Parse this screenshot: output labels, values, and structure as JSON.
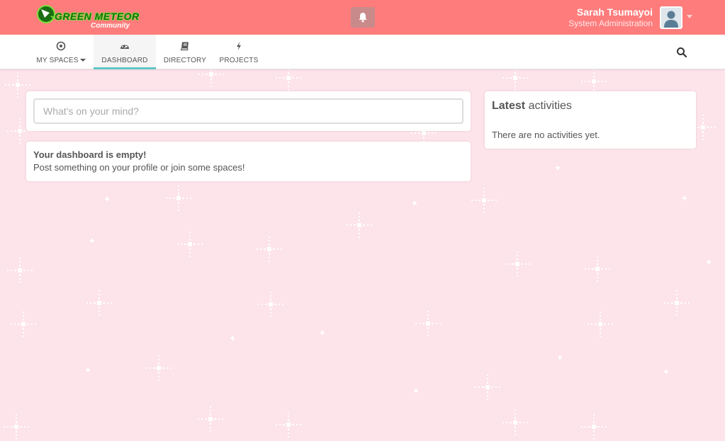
{
  "brand": {
    "name": "GREEN METEOR",
    "subtitle": "Community",
    "accent_color": "#fe7c7c",
    "logo_green": "#1a6e12"
  },
  "header": {
    "notification_icon": "bell-icon",
    "user": {
      "name": "Sarah Tsumayoi",
      "role": "System Administration"
    }
  },
  "nav": {
    "items": [
      {
        "label": "MY SPACES",
        "icon": "target-icon",
        "has_dropdown": true
      },
      {
        "label": "DASHBOARD",
        "icon": "dashboard-icon",
        "active": true
      },
      {
        "label": "DIRECTORY",
        "icon": "book-icon"
      },
      {
        "label": "PROJECTS",
        "icon": "bolt-icon"
      }
    ],
    "search_icon": "search-icon",
    "active_color": "#5fc6c6"
  },
  "post": {
    "placeholder": "What's on your mind?"
  },
  "dashboard": {
    "empty_title": "Your dashboard is empty!",
    "empty_text": "Post something on your profile or join some spaces!"
  },
  "activities": {
    "title_bold": "Latest",
    "title_rest": "activities",
    "empty_text": "There are no activities yet."
  },
  "background_color": "#fde3ea"
}
